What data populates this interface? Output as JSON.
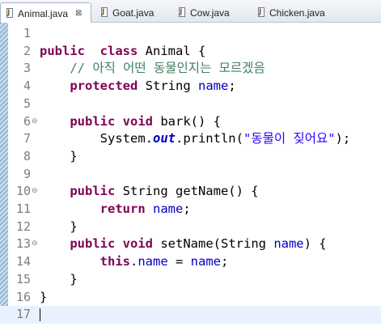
{
  "tabs": [
    {
      "label": "Animal.java",
      "active": true,
      "close": "⊠"
    },
    {
      "label": "Goat.java",
      "active": false
    },
    {
      "label": "Cow.java",
      "active": false
    },
    {
      "label": "Chicken.java",
      "active": false
    }
  ],
  "editor": {
    "current_line": 17,
    "lines": [
      {
        "n": "1",
        "tokens": []
      },
      {
        "n": "2",
        "tokens": [
          [
            "kw",
            "public"
          ],
          [
            "",
            "  "
          ],
          [
            "kw",
            "class"
          ],
          [
            "",
            " Animal {"
          ]
        ]
      },
      {
        "n": "3",
        "tokens": [
          [
            "",
            "    "
          ],
          [
            "comment",
            "// 아직 어떤 동물인지는 모르겠음"
          ]
        ]
      },
      {
        "n": "4",
        "tokens": [
          [
            "",
            "    "
          ],
          [
            "kw",
            "protected"
          ],
          [
            "",
            " String "
          ],
          [
            "field",
            "name"
          ],
          [
            "",
            ";"
          ]
        ]
      },
      {
        "n": "5",
        "tokens": []
      },
      {
        "n": "6",
        "fold": "⊖",
        "tokens": [
          [
            "",
            "    "
          ],
          [
            "kw",
            "public"
          ],
          [
            "",
            " "
          ],
          [
            "kw",
            "void"
          ],
          [
            "",
            " bark() {"
          ]
        ]
      },
      {
        "n": "7",
        "tokens": [
          [
            "",
            "        System."
          ],
          [
            "static",
            "out"
          ],
          [
            "",
            ".println("
          ],
          [
            "str",
            "\"동물이 짖어요\""
          ],
          [
            "",
            ");"
          ]
        ]
      },
      {
        "n": "8",
        "tokens": [
          [
            "",
            "    }"
          ]
        ]
      },
      {
        "n": "9",
        "tokens": []
      },
      {
        "n": "10",
        "fold": "⊖",
        "tokens": [
          [
            "",
            "    "
          ],
          [
            "kw",
            "public"
          ],
          [
            "",
            " String getName() {"
          ]
        ]
      },
      {
        "n": "11",
        "tokens": [
          [
            "",
            "        "
          ],
          [
            "kw",
            "return"
          ],
          [
            "",
            " "
          ],
          [
            "field",
            "name"
          ],
          [
            "",
            ";"
          ]
        ]
      },
      {
        "n": "12",
        "tokens": [
          [
            "",
            "    }"
          ]
        ]
      },
      {
        "n": "13",
        "fold": "⊖",
        "tokens": [
          [
            "",
            "    "
          ],
          [
            "kw",
            "public"
          ],
          [
            "",
            " "
          ],
          [
            "kw",
            "void"
          ],
          [
            "",
            " setName(String "
          ],
          [
            "field",
            "name"
          ],
          [
            "",
            ") {"
          ]
        ]
      },
      {
        "n": "14",
        "tokens": [
          [
            "",
            "        "
          ],
          [
            "kw",
            "this"
          ],
          [
            "",
            "."
          ],
          [
            "field",
            "name"
          ],
          [
            "",
            " = "
          ],
          [
            "field",
            "name"
          ],
          [
            "",
            ";"
          ]
        ]
      },
      {
        "n": "15",
        "tokens": [
          [
            "",
            "    }"
          ]
        ]
      },
      {
        "n": "16",
        "tokens": [
          [
            "",
            "}"
          ]
        ]
      },
      {
        "n": "17",
        "tokens": []
      }
    ]
  }
}
